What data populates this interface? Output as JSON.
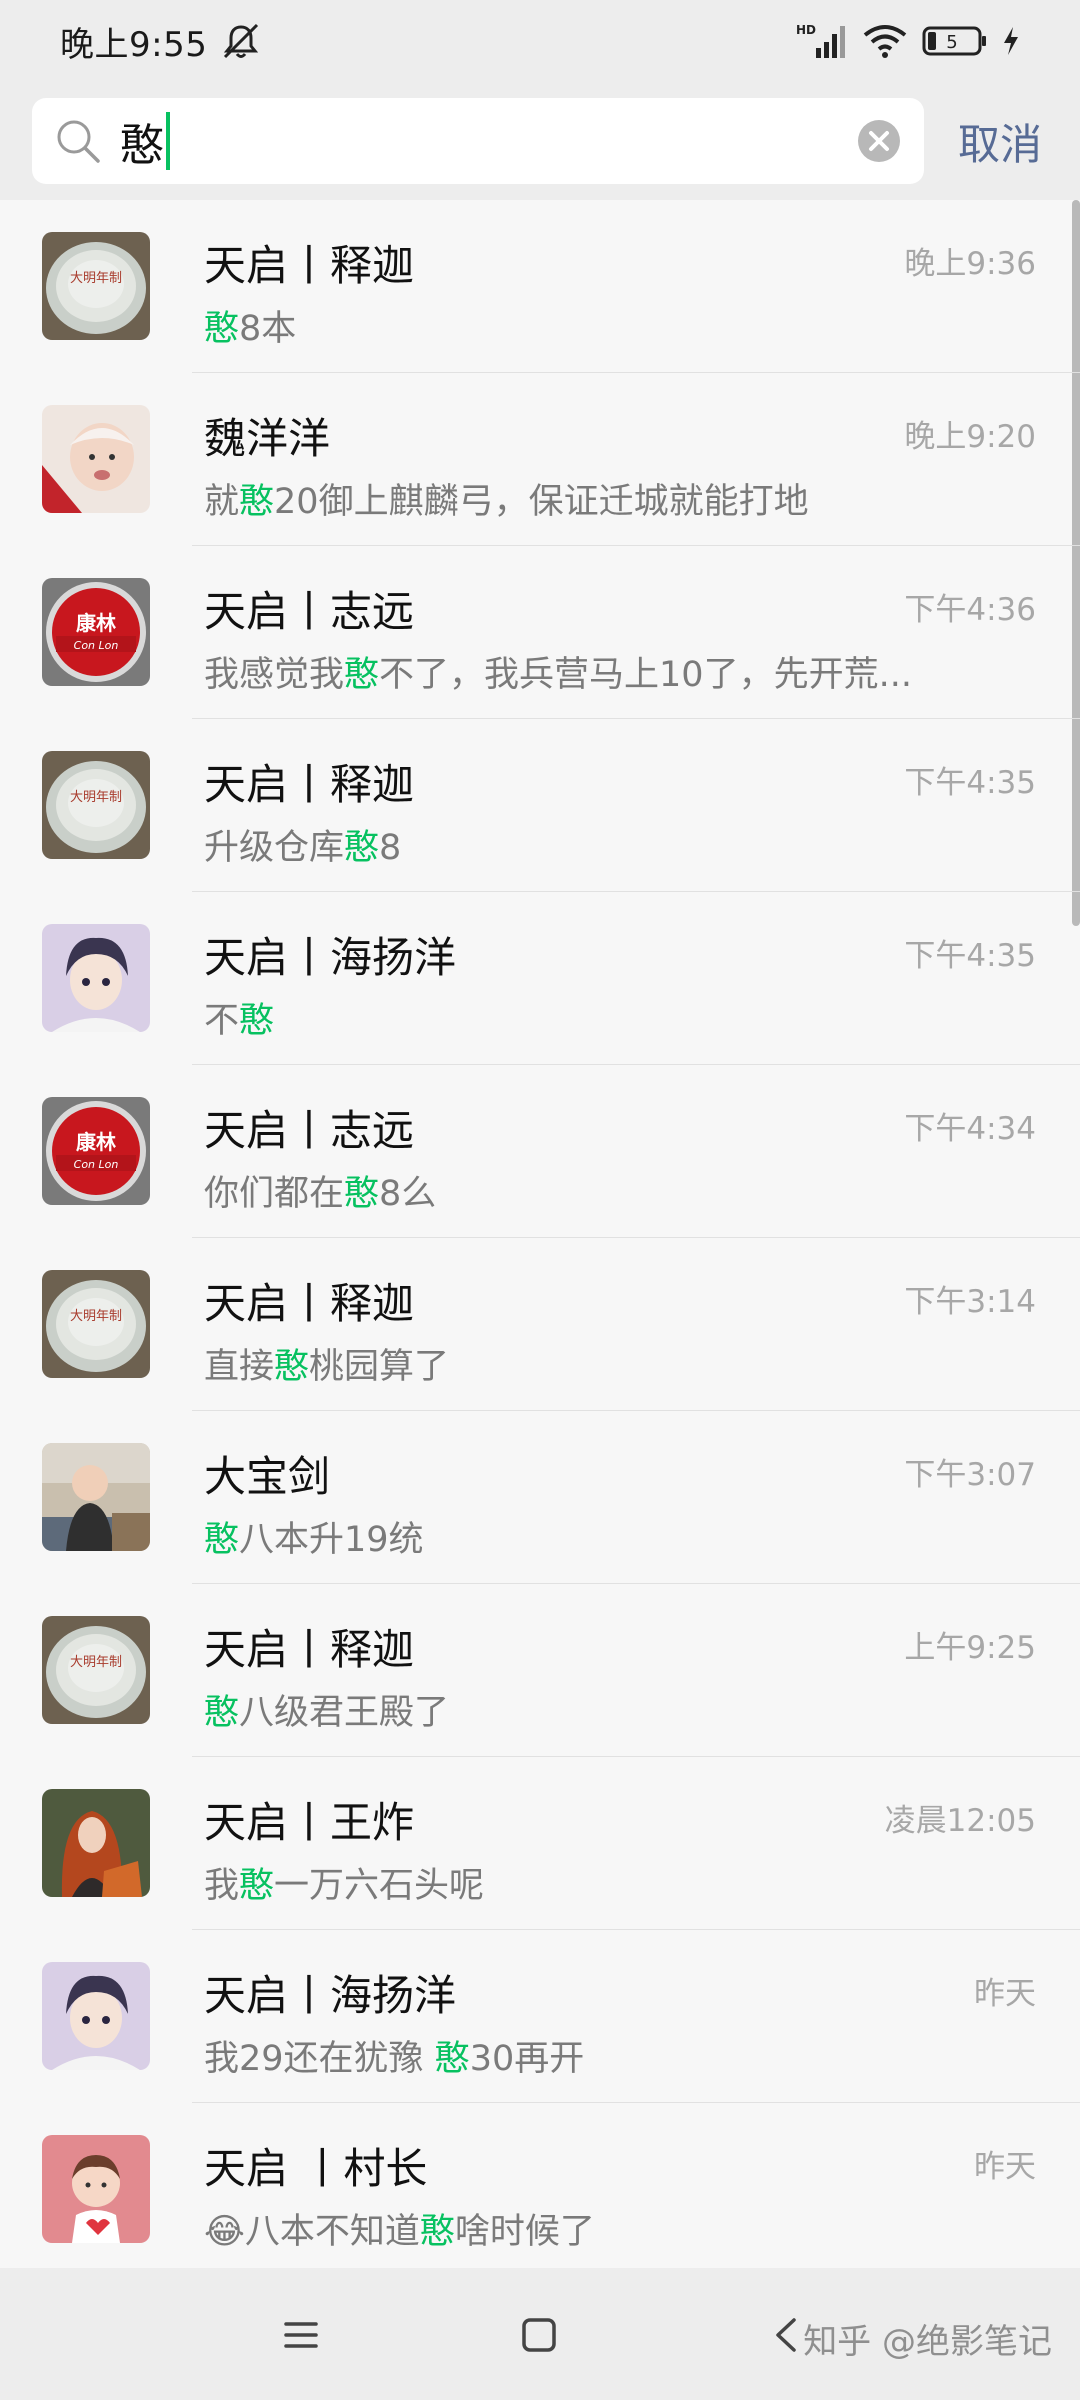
{
  "status_bar": {
    "time": "晚上9:55",
    "battery_level": "5",
    "icons": [
      "silent-icon",
      "hd-signal-icon",
      "wifi-icon",
      "battery-icon",
      "charging-icon"
    ]
  },
  "search": {
    "query": "憨",
    "cancel_label": "取消"
  },
  "colors": {
    "highlight": "#07c160",
    "link": "#576b95",
    "time_gray": "#a7a7a7"
  },
  "results": [
    {
      "name": "天启丨释迦",
      "time": "晚上9:36",
      "msg_pre": "",
      "msg_hl": "憨",
      "msg_post": "8本",
      "avatar": "porcelain"
    },
    {
      "name": "魏洋洋",
      "time": "晚上9:20",
      "msg_pre": "就",
      "msg_hl": "憨",
      "msg_post": "20御上麒麟弓，保证迁城就能打地",
      "avatar": "baby"
    },
    {
      "name": "天启丨志远",
      "time": "下午4:36",
      "msg_pre": "我感觉我",
      "msg_hl": "憨",
      "msg_post": "不了，我兵营马上10了，先开荒...",
      "avatar": "conlon"
    },
    {
      "name": "天启丨释迦",
      "time": "下午4:35",
      "msg_pre": "升级仓库",
      "msg_hl": "憨",
      "msg_post": "8",
      "avatar": "porcelain"
    },
    {
      "name": "天启丨海扬洋",
      "time": "下午4:35",
      "msg_pre": "不",
      "msg_hl": "憨",
      "msg_post": "",
      "avatar": "anime"
    },
    {
      "name": "天启丨志远",
      "time": "下午4:34",
      "msg_pre": "你们都在",
      "msg_hl": "憨",
      "msg_post": "8么",
      "avatar": "conlon"
    },
    {
      "name": "天启丨释迦",
      "time": "下午3:14",
      "msg_pre": "直接",
      "msg_hl": "憨",
      "msg_post": "桃园算了",
      "avatar": "porcelain"
    },
    {
      "name": "大宝剑",
      "time": "下午3:07",
      "msg_pre": "",
      "msg_hl": "憨",
      "msg_post": "八本升19统",
      "avatar": "child"
    },
    {
      "name": "天启丨释迦",
      "time": "上午9:25",
      "msg_pre": "",
      "msg_hl": "憨",
      "msg_post": "八级君王殿了",
      "avatar": "porcelain"
    },
    {
      "name": "天启丨王炸",
      "time": "凌晨12:05",
      "msg_pre": "我",
      "msg_hl": "憨",
      "msg_post": "一万六石头呢",
      "avatar": "redhead"
    },
    {
      "name": "天启丨海扬洋",
      "time": "昨天",
      "msg_pre": "我29还在犹豫 ",
      "msg_hl": "憨",
      "msg_post": "30再开",
      "avatar": "anime"
    },
    {
      "name": "天启 丨村长",
      "time": "昨天",
      "msg_pre": "😂八本不知道",
      "msg_hl": "憨",
      "msg_post": "啥时候了",
      "avatar": "cartoon"
    }
  ],
  "avatar_logo_text": {
    "porcelain": "大明年制",
    "conlon_cn": "康林",
    "conlon_en": "Con Lon"
  },
  "nav": {
    "buttons": [
      "menu-icon",
      "home-icon",
      "back-icon"
    ],
    "watermark": "知乎 @绝影笔记"
  }
}
